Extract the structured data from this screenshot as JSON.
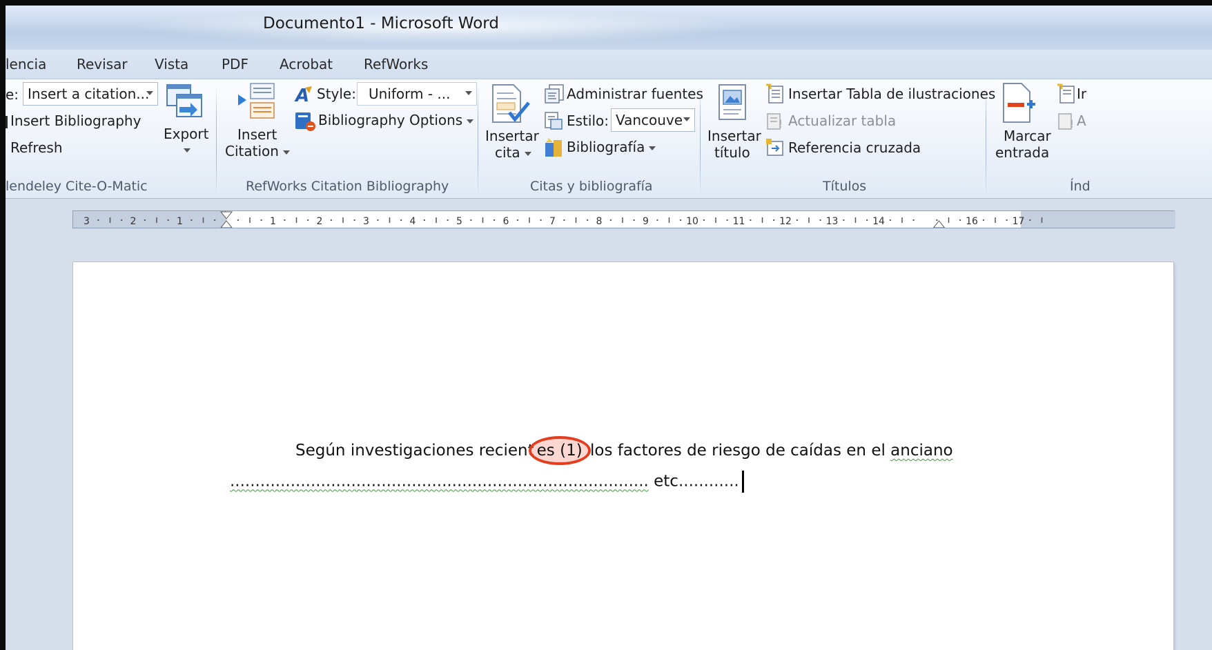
{
  "window": {
    "title": "Documento1  -  Microsoft Word"
  },
  "tabs": [
    "Referencia",
    "Revisar",
    "Vista",
    "PDF",
    "Acrobat",
    "RefWorks"
  ],
  "tab_labels_visible": [
    "lencia",
    "Revisar",
    "Vista",
    "PDF",
    "Acrobat",
    "RefWorks"
  ],
  "ribbon": {
    "mendeley": {
      "style_label": "e:",
      "citation_select": "Insert a citation...",
      "insert_bibliography": "Insert Bibliography",
      "refresh": "Refresh",
      "export": "Export",
      "group_label": "lendeley Cite-O-Matic"
    },
    "refworks": {
      "insert_citation_line1": "Insert",
      "insert_citation_line2": "Citation",
      "style_label": "Style:",
      "style_value": "Uniform - ...",
      "bibliography_options": "Bibliography Options",
      "group_label": "RefWorks Citation  Bibliography"
    },
    "citas": {
      "insertar_cita_line1": "Insertar",
      "insertar_cita_line2": "cita",
      "administrar_fuentes": "Administrar fuentes",
      "estilo_label": "Estilo:",
      "estilo_value": "Vancouve",
      "bibliografia": "Bibliografía",
      "group_label": "Citas y bibliografía"
    },
    "titulos": {
      "insertar_titulo_line1": "Insertar",
      "insertar_titulo_line2": "título",
      "insertar_tabla": "Insertar Tabla de ilustraciones",
      "actualizar_tabla": "Actualizar tabla",
      "referencia_cruzada": "Referencia cruzada",
      "group_label": "Títulos"
    },
    "indice": {
      "marcar_entrada_line1": "Marcar",
      "marcar_entrada_line2": "entrada",
      "insertar_partial": "Ir",
      "actualizar_partial": "A",
      "group_label": "Índ"
    }
  },
  "ruler": {
    "numbers": [
      "3",
      "2",
      "1",
      "1",
      "2",
      "3",
      "4",
      "5",
      "6",
      "7",
      "8",
      "9",
      "10",
      "11",
      "12",
      "13",
      "14",
      "16",
      "17"
    ]
  },
  "document": {
    "line1_before": "Según investigaciones recient",
    "line1_es": "es",
    "citation": "(1)",
    "line1_after": " los factores de riesgo de caídas en el ",
    "line1_word": "anciano",
    "line2_dots": "...................................................................................",
    "line2_tail": "  etc............"
  },
  "colors": {
    "highlight_circle": "#e43d1e",
    "ribbon_bg": "#eef3fa",
    "doc_bg": "#d6dee9"
  }
}
